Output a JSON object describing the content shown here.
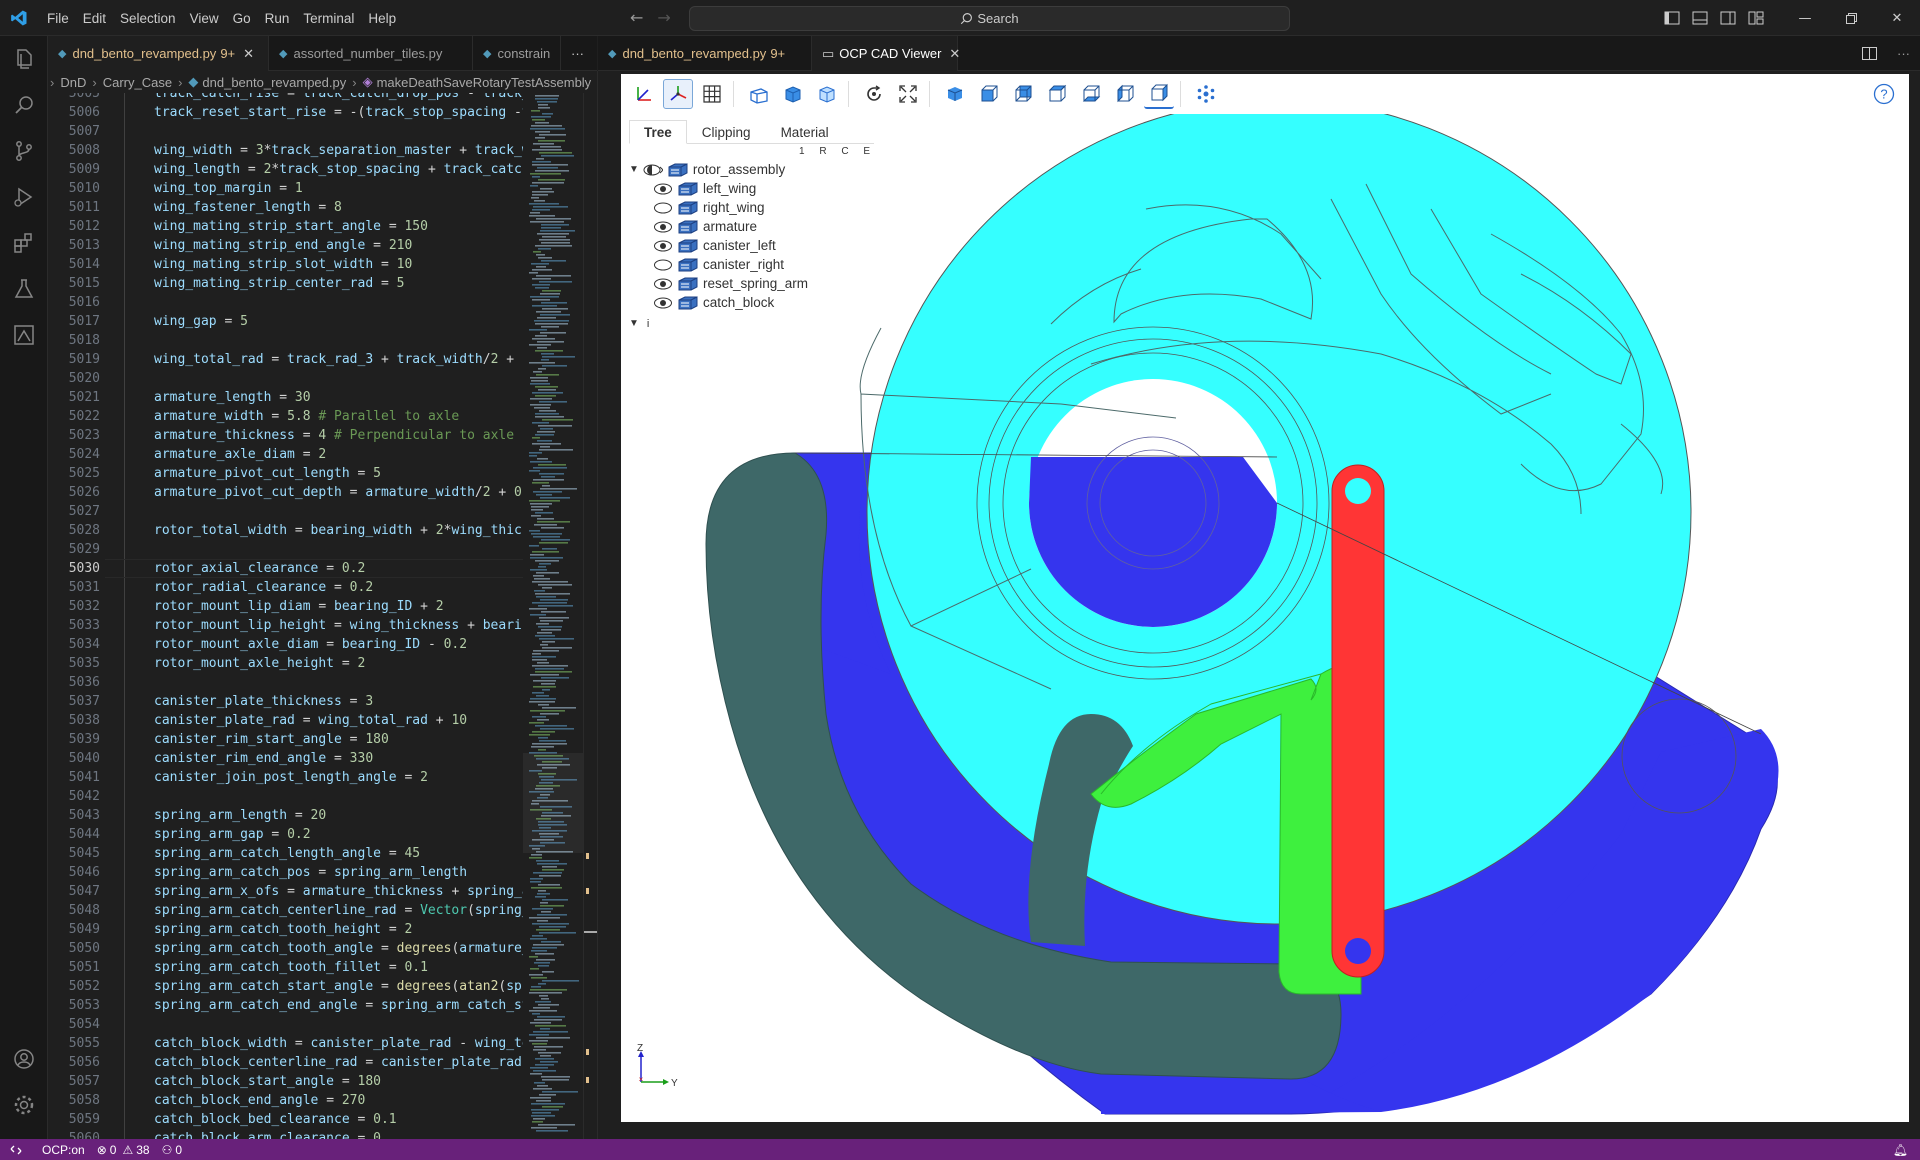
{
  "menu": [
    "File",
    "Edit",
    "Selection",
    "View",
    "Go",
    "Run",
    "Terminal",
    "Help"
  ],
  "search": {
    "label": "Search"
  },
  "left_tabs": [
    {
      "label": "dnd_bento_revamped.py",
      "mod": "9+",
      "active": true
    },
    {
      "label": "assorted_number_tiles.py",
      "mod": "",
      "active": false
    },
    {
      "label": "constrain",
      "mod": "",
      "active": false
    }
  ],
  "right_tabs": [
    {
      "label": "dnd_bento_revamped.py",
      "mod": "9+"
    },
    {
      "label": "OCP CAD Viewer"
    }
  ],
  "breadcrumb": [
    "DnD",
    "Carry_Case",
    "dnd_bento_revamped.py",
    "makeDeathSaveRotaryTestAssembly"
  ],
  "code": {
    "current_line": 5030,
    "lines": [
      {
        "n": 5005,
        "t": "track_catch_rise = track_catch_drop_pos - track_"
      },
      {
        "n": 5006,
        "t": "track_reset_start_rise = -(track_stop_spacing -t"
      },
      {
        "n": 5007,
        "t": ""
      },
      {
        "n": 5008,
        "t": "wing_width = 3*track_separation_master + track_w"
      },
      {
        "n": 5009,
        "t": "wing_length = 2*track_stop_spacing + track_catch"
      },
      {
        "n": 5010,
        "t": "wing_top_margin = 1"
      },
      {
        "n": 5011,
        "t": "wing_fastener_length = 8"
      },
      {
        "n": 5012,
        "t": "wing_mating_strip_start_angle = 150"
      },
      {
        "n": 5013,
        "t": "wing_mating_strip_end_angle = 210"
      },
      {
        "n": 5014,
        "t": "wing_mating_strip_slot_width = 10"
      },
      {
        "n": 5015,
        "t": "wing_mating_strip_center_rad = 5"
      },
      {
        "n": 5016,
        "t": ""
      },
      {
        "n": 5017,
        "t": "wing_gap = 5"
      },
      {
        "n": 5018,
        "t": ""
      },
      {
        "n": 5019,
        "t": "wing_total_rad = track_rad_3 + track_width/2 + 1"
      },
      {
        "n": 5020,
        "t": ""
      },
      {
        "n": 5021,
        "t": "armature_length = 30"
      },
      {
        "n": 5022,
        "t": "armature_width = 5.8 # Parallel to axle"
      },
      {
        "n": 5023,
        "t": "armature_thickness = 4 # Perpendicular to axle"
      },
      {
        "n": 5024,
        "t": "armature_axle_diam = 2"
      },
      {
        "n": 5025,
        "t": "armature_pivot_cut_length = 5"
      },
      {
        "n": 5026,
        "t": "armature_pivot_cut_depth = armature_width/2 + 0."
      },
      {
        "n": 5027,
        "t": ""
      },
      {
        "n": 5028,
        "t": "rotor_total_width = bearing_width + 2*wing_thick"
      },
      {
        "n": 5029,
        "t": ""
      },
      {
        "n": 5030,
        "t": "rotor_axial_clearance = 0.2"
      },
      {
        "n": 5031,
        "t": "rotor_radial_clearance = 0.2"
      },
      {
        "n": 5032,
        "t": "rotor_mount_lip_diam = bearing_ID + 2"
      },
      {
        "n": 5033,
        "t": "rotor_mount_lip_height = wing_thickness + bearin"
      },
      {
        "n": 5034,
        "t": "rotor_mount_axle_diam = bearing_ID - 0.2"
      },
      {
        "n": 5035,
        "t": "rotor_mount_axle_height = 2"
      },
      {
        "n": 5036,
        "t": ""
      },
      {
        "n": 5037,
        "t": "canister_plate_thickness = 3"
      },
      {
        "n": 5038,
        "t": "canister_plate_rad = wing_total_rad + 10"
      },
      {
        "n": 5039,
        "t": "canister_rim_start_angle = 180"
      },
      {
        "n": 5040,
        "t": "canister_rim_end_angle = 330"
      },
      {
        "n": 5041,
        "t": "canister_join_post_length_angle = 2"
      },
      {
        "n": 5042,
        "t": ""
      },
      {
        "n": 5043,
        "t": "spring_arm_length = 20"
      },
      {
        "n": 5044,
        "t": "spring_arm_gap = 0.2"
      },
      {
        "n": 5045,
        "t": "spring_arm_catch_length_angle = 45"
      },
      {
        "n": 5046,
        "t": "spring_arm_catch_pos = spring_arm_length"
      },
      {
        "n": 5047,
        "t": "spring_arm_x_ofs = armature_thickness + spring_a"
      },
      {
        "n": 5048,
        "t": "spring_arm_catch_centerline_rad = Vector(spring_"
      },
      {
        "n": 5049,
        "t": "spring_arm_catch_tooth_height = 2"
      },
      {
        "n": 5050,
        "t": "spring_arm_catch_tooth_angle = degrees(armature_"
      },
      {
        "n": 5051,
        "t": "spring_arm_catch_tooth_fillet = 0.1"
      },
      {
        "n": 5052,
        "t": "spring_arm_catch_start_angle = degrees(atan2(spr"
      },
      {
        "n": 5053,
        "t": "spring_arm_catch_end_angle = spring_arm_catch_st"
      },
      {
        "n": 5054,
        "t": ""
      },
      {
        "n": 5055,
        "t": "catch_block_width = canister_plate_rad - wing_to"
      },
      {
        "n": 5056,
        "t": "catch_block_centerline_rad = canister_plate_rad "
      },
      {
        "n": 5057,
        "t": "catch_block_start_angle = 180"
      },
      {
        "n": 5058,
        "t": "catch_block_end_angle = 270"
      },
      {
        "n": 5059,
        "t": "catch_block_bed_clearance = 0.1"
      },
      {
        "n": 5060,
        "t": "catch_block_arm_clearance = 0."
      }
    ]
  },
  "ocp": {
    "tabs": [
      "Tree",
      "Clipping",
      "Material"
    ],
    "rce": "1 R C E",
    "root": "rotor_assembly",
    "items": [
      {
        "label": "left_wing",
        "visible": true
      },
      {
        "label": "right_wing",
        "visible": false
      },
      {
        "label": "armature",
        "visible": true
      },
      {
        "label": "canister_left",
        "visible": true
      },
      {
        "label": "canister_right",
        "visible": false
      },
      {
        "label": "reset_spring_arm",
        "visible": true
      },
      {
        "label": "catch_block",
        "visible": true
      }
    ],
    "info_label": "i",
    "axis_z": "Z",
    "axis_y": "Y",
    "colors": {
      "wing": "#35ffff",
      "canister": "#3535ee",
      "catch_block": "#3e6868",
      "spring_arm": "#3ef03e",
      "armature": "#ff3535"
    }
  },
  "status": {
    "remote": "OCP:on",
    "errors": "0",
    "warnings": "38",
    "ports": "0"
  }
}
